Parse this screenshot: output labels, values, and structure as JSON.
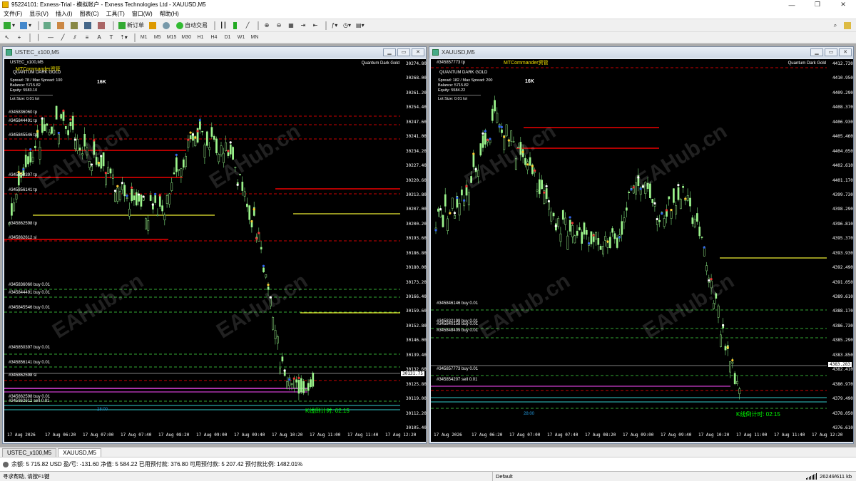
{
  "window": {
    "title": "95224101: Exness-Trial - 模拟帐户 - Exness Technologies Ltd - XAUUSD,M5",
    "min": "—",
    "max": "❐",
    "close": "✕"
  },
  "menu": [
    "文件(F)",
    "显示(V)",
    "插入(I)",
    "图表(C)",
    "工具(T)",
    "窗口(W)",
    "帮助(H)"
  ],
  "toolbar": {
    "new_order": "新订单",
    "auto_trading": "自动交易",
    "timeframes": [
      "M1",
      "M5",
      "M15",
      "M30",
      "H1",
      "H4",
      "D1",
      "W1",
      "MN"
    ]
  },
  "charts": [
    {
      "title": "USTEC_x100,M5",
      "symbol_label": "USTEC_x100,M5",
      "indicator": "MTCommander资管",
      "theme": "QUANTUM DARK GOLD",
      "theme_right": "Quantum Dark Gold",
      "spread": "Spread:  78 / Max Spread: 100",
      "balance": "Balance:   5715.82",
      "equity": "Equity:     5583.10",
      "lot": "Lot Size:   0.01 lot",
      "badge": "16K",
      "prices": [
        "30274.80",
        "30268.00",
        "30261.20",
        "30254.40",
        "30247.60",
        "30241.00",
        "30234.20",
        "30227.40",
        "30220.60",
        "30213.80",
        "30207.00",
        "30200.20",
        "30193.60",
        "30186.80",
        "30180.00",
        "30173.20",
        "30166.40",
        "30159.60",
        "30152.80",
        "30146.00",
        "30139.40",
        "30132.60",
        "30125.80",
        "30119.00",
        "30112.20",
        "30105.40"
      ],
      "current_price": "30131.75",
      "times": [
        "17 Aug 2026",
        "17 Aug 06:20",
        "17 Aug 07:00",
        "17 Aug 07:40",
        "17 Aug 08:20",
        "17 Aug 09:00",
        "17 Aug 09:40",
        "17 Aug 10:20",
        "17 Aug 11:00",
        "17 Aug 11:40",
        "17 Aug 12:20"
      ],
      "orders_top": [
        "#345836060 tp",
        "#345844491 tp",
        "#345845546 tp",
        "#345850397 tp",
        "#345856141 tp",
        "#345862598 tp",
        "#345862612 sl"
      ],
      "orders_bottom": [
        "#345836060 buy 0.01",
        "#345844491 buy 0.01",
        "#345845546 buy 0.01",
        "#345850397 buy 0.01",
        "#345856141 buy 0.01",
        "#345862598 sl",
        "#345862598 buy 0.01",
        "#345862612 sell 0.01"
      ],
      "countdown": "K线倒计时: 02:15",
      "time_marker": "28:00"
    },
    {
      "title": "XAUUSD,M5",
      "symbol_label": "#345857773 tp",
      "indicator": "MTCommander资管",
      "theme": "QUANTUM DARK GOLD",
      "theme_right": "Quantum Dark Gold",
      "spread": "Spread:  182 / Max Spread: 200",
      "balance": "Balance:   5715.82",
      "equity": "Equity:     5584.22",
      "lot": "Lot Size:   0.01 lot",
      "badge": "16K",
      "prices": [
        "4412.730",
        "4410.950",
        "4409.290",
        "4408.370",
        "4406.930",
        "4405.460",
        "4404.050",
        "4402.610",
        "4401.170",
        "4399.730",
        "4398.290",
        "4396.810",
        "4395.370",
        "4393.930",
        "4392.490",
        "4391.050",
        "4389.610",
        "4388.170",
        "4386.730",
        "4385.290",
        "4383.850",
        "4382.410",
        "4380.970",
        "4379.490",
        "4378.050",
        "4376.610"
      ],
      "current_price": "4383.283",
      "times": [
        "17 Aug 2026",
        "17 Aug 06:20",
        "17 Aug 07:00",
        "17 Aug 07:40",
        "17 Aug 08:20",
        "17 Aug 09:00",
        "17 Aug 09:40",
        "17 Aug 10:20",
        "17 Aug 11:00",
        "17 Aug 11:40",
        "17 Aug 12:20"
      ],
      "orders_bottom": [
        "#345846146 buy 0.01",
        "#345832199 buy 0.01",
        "#345840158 buy 0.01",
        "#345848409 buy 0.01",
        "#345857773 buy 0.01",
        "#345854207 sell 0.01"
      ],
      "countdown": "K线倒计时: 02:15",
      "time_marker": "28:00"
    }
  ],
  "tabs": [
    "USTEC_x100,M5",
    "XAUUSD,M5"
  ],
  "account": "余额: 5 715.82 USD  盈/亏: -131.60  净值: 5 584.22  已用预付款: 376.80  可用预付款: 5 207.42  预付款比例: 1482.01%",
  "status": {
    "help": "寻求帮助, 请按F1键",
    "profile": "Default",
    "traffic": "26249/611 kb"
  },
  "watermark": "EAHub.cn"
}
